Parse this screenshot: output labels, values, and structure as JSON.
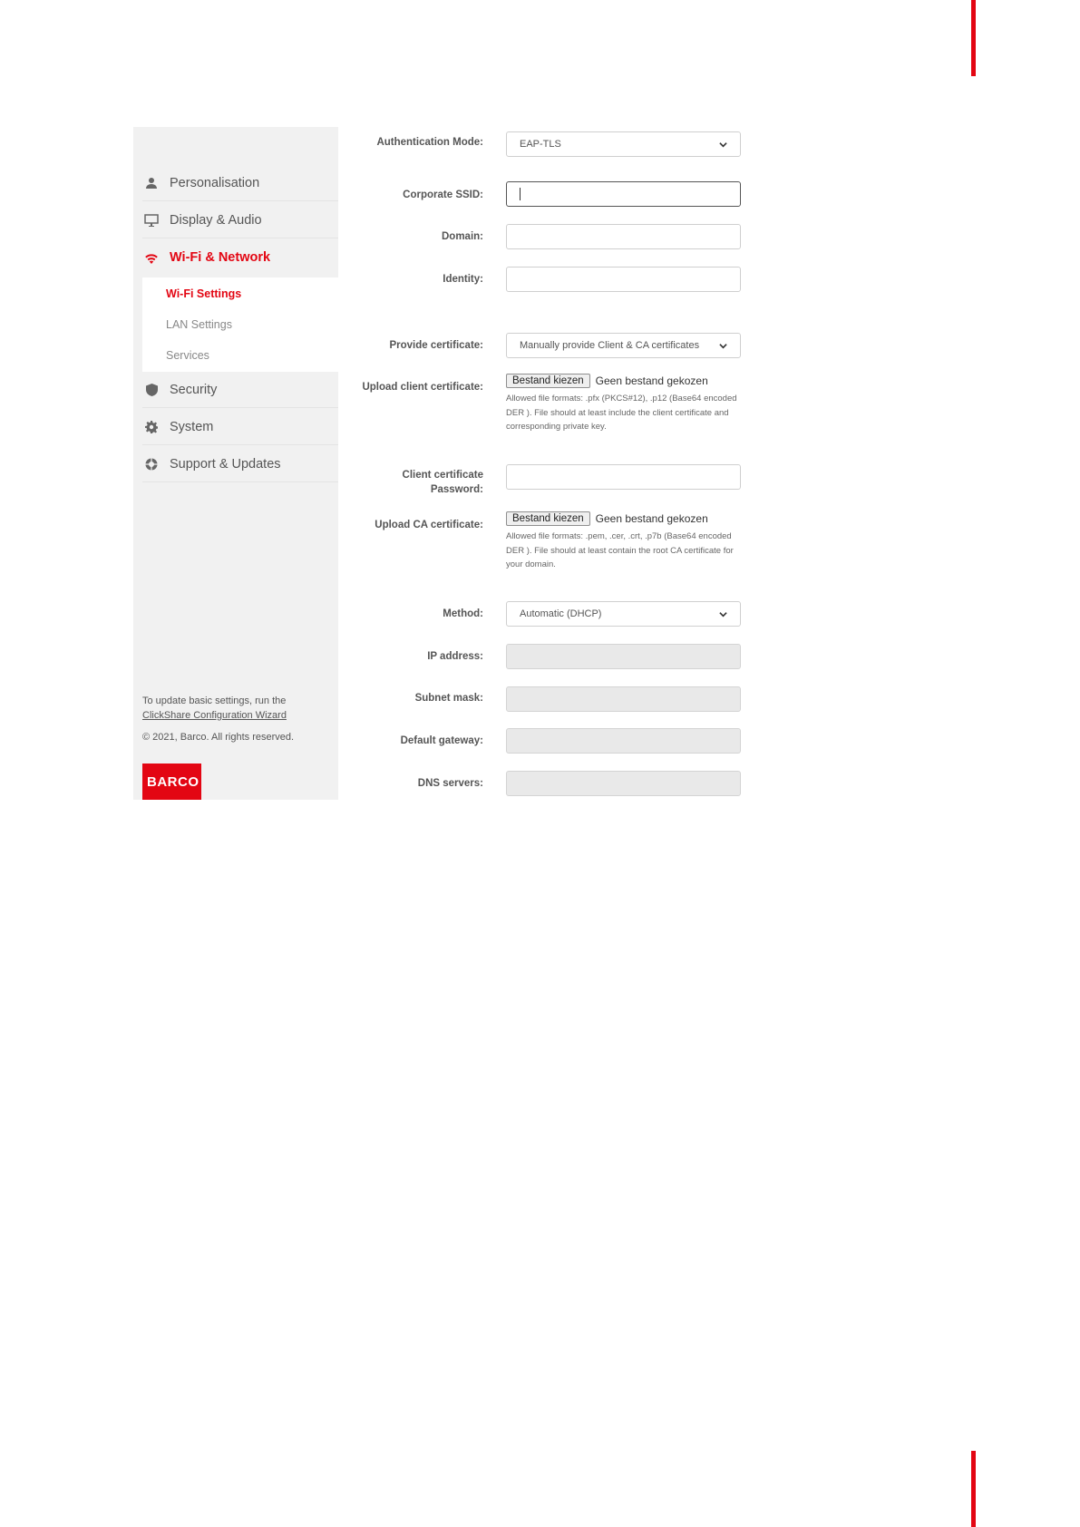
{
  "sidebar": {
    "items": [
      {
        "label": "Personalisation",
        "icon": "user-icon"
      },
      {
        "label": "Display & Audio",
        "icon": "monitor-icon"
      },
      {
        "label": "Wi-Fi & Network",
        "icon": "wifi-icon",
        "active": true
      },
      {
        "label": "Security",
        "icon": "shield-icon"
      },
      {
        "label": "System",
        "icon": "gear-icon"
      },
      {
        "label": "Support & Updates",
        "icon": "lifebuoy-icon"
      }
    ],
    "submenu": [
      "Wi-Fi Settings",
      "LAN Settings",
      "Services"
    ],
    "footer": {
      "text": "To update basic settings, run the",
      "link": "ClickShare Configuration Wizard",
      "copyright": "© 2021, Barco. All rights reserved."
    },
    "logo": "BARCO"
  },
  "form": {
    "auth_mode_label": "Authentication Mode:",
    "auth_mode_value": "EAP-TLS",
    "ssid_label": "Corporate SSID:",
    "ssid_value": "",
    "domain_label": "Domain:",
    "domain_value": "",
    "identity_label": "Identity:",
    "identity_value": "",
    "cert_label": "Provide certificate:",
    "cert_value": "Manually provide Client & CA certificates",
    "client_cert_label": "Upload client certificate:",
    "client_cert_button": "Bestand kiezen",
    "client_cert_status": "Geen bestand gekozen",
    "client_cert_help": "Allowed file formats: .pfx (PKCS#12), .p12 (Base64 encoded DER ). File should at least include the client certificate and corresponding private key.",
    "client_pw_label": "Client certificate Password:",
    "client_pw_value": "",
    "ca_cert_label": "Upload CA certificate:",
    "ca_cert_button": "Bestand kiezen",
    "ca_cert_status": "Geen bestand gekozen",
    "ca_cert_help": "Allowed file formats: .pem, .cer, .crt, .p7b (Base64 encoded DER ). File should at least contain the root CA certificate for your domain.",
    "method_label": "Method:",
    "method_value": "Automatic (DHCP)",
    "ip_label": "IP address:",
    "subnet_label": "Subnet mask:",
    "gateway_label": "Default gateway:",
    "dns_label": "DNS servers:"
  },
  "colors": {
    "accent": "#e30613",
    "sidebar_bg": "#f1f1f1"
  }
}
